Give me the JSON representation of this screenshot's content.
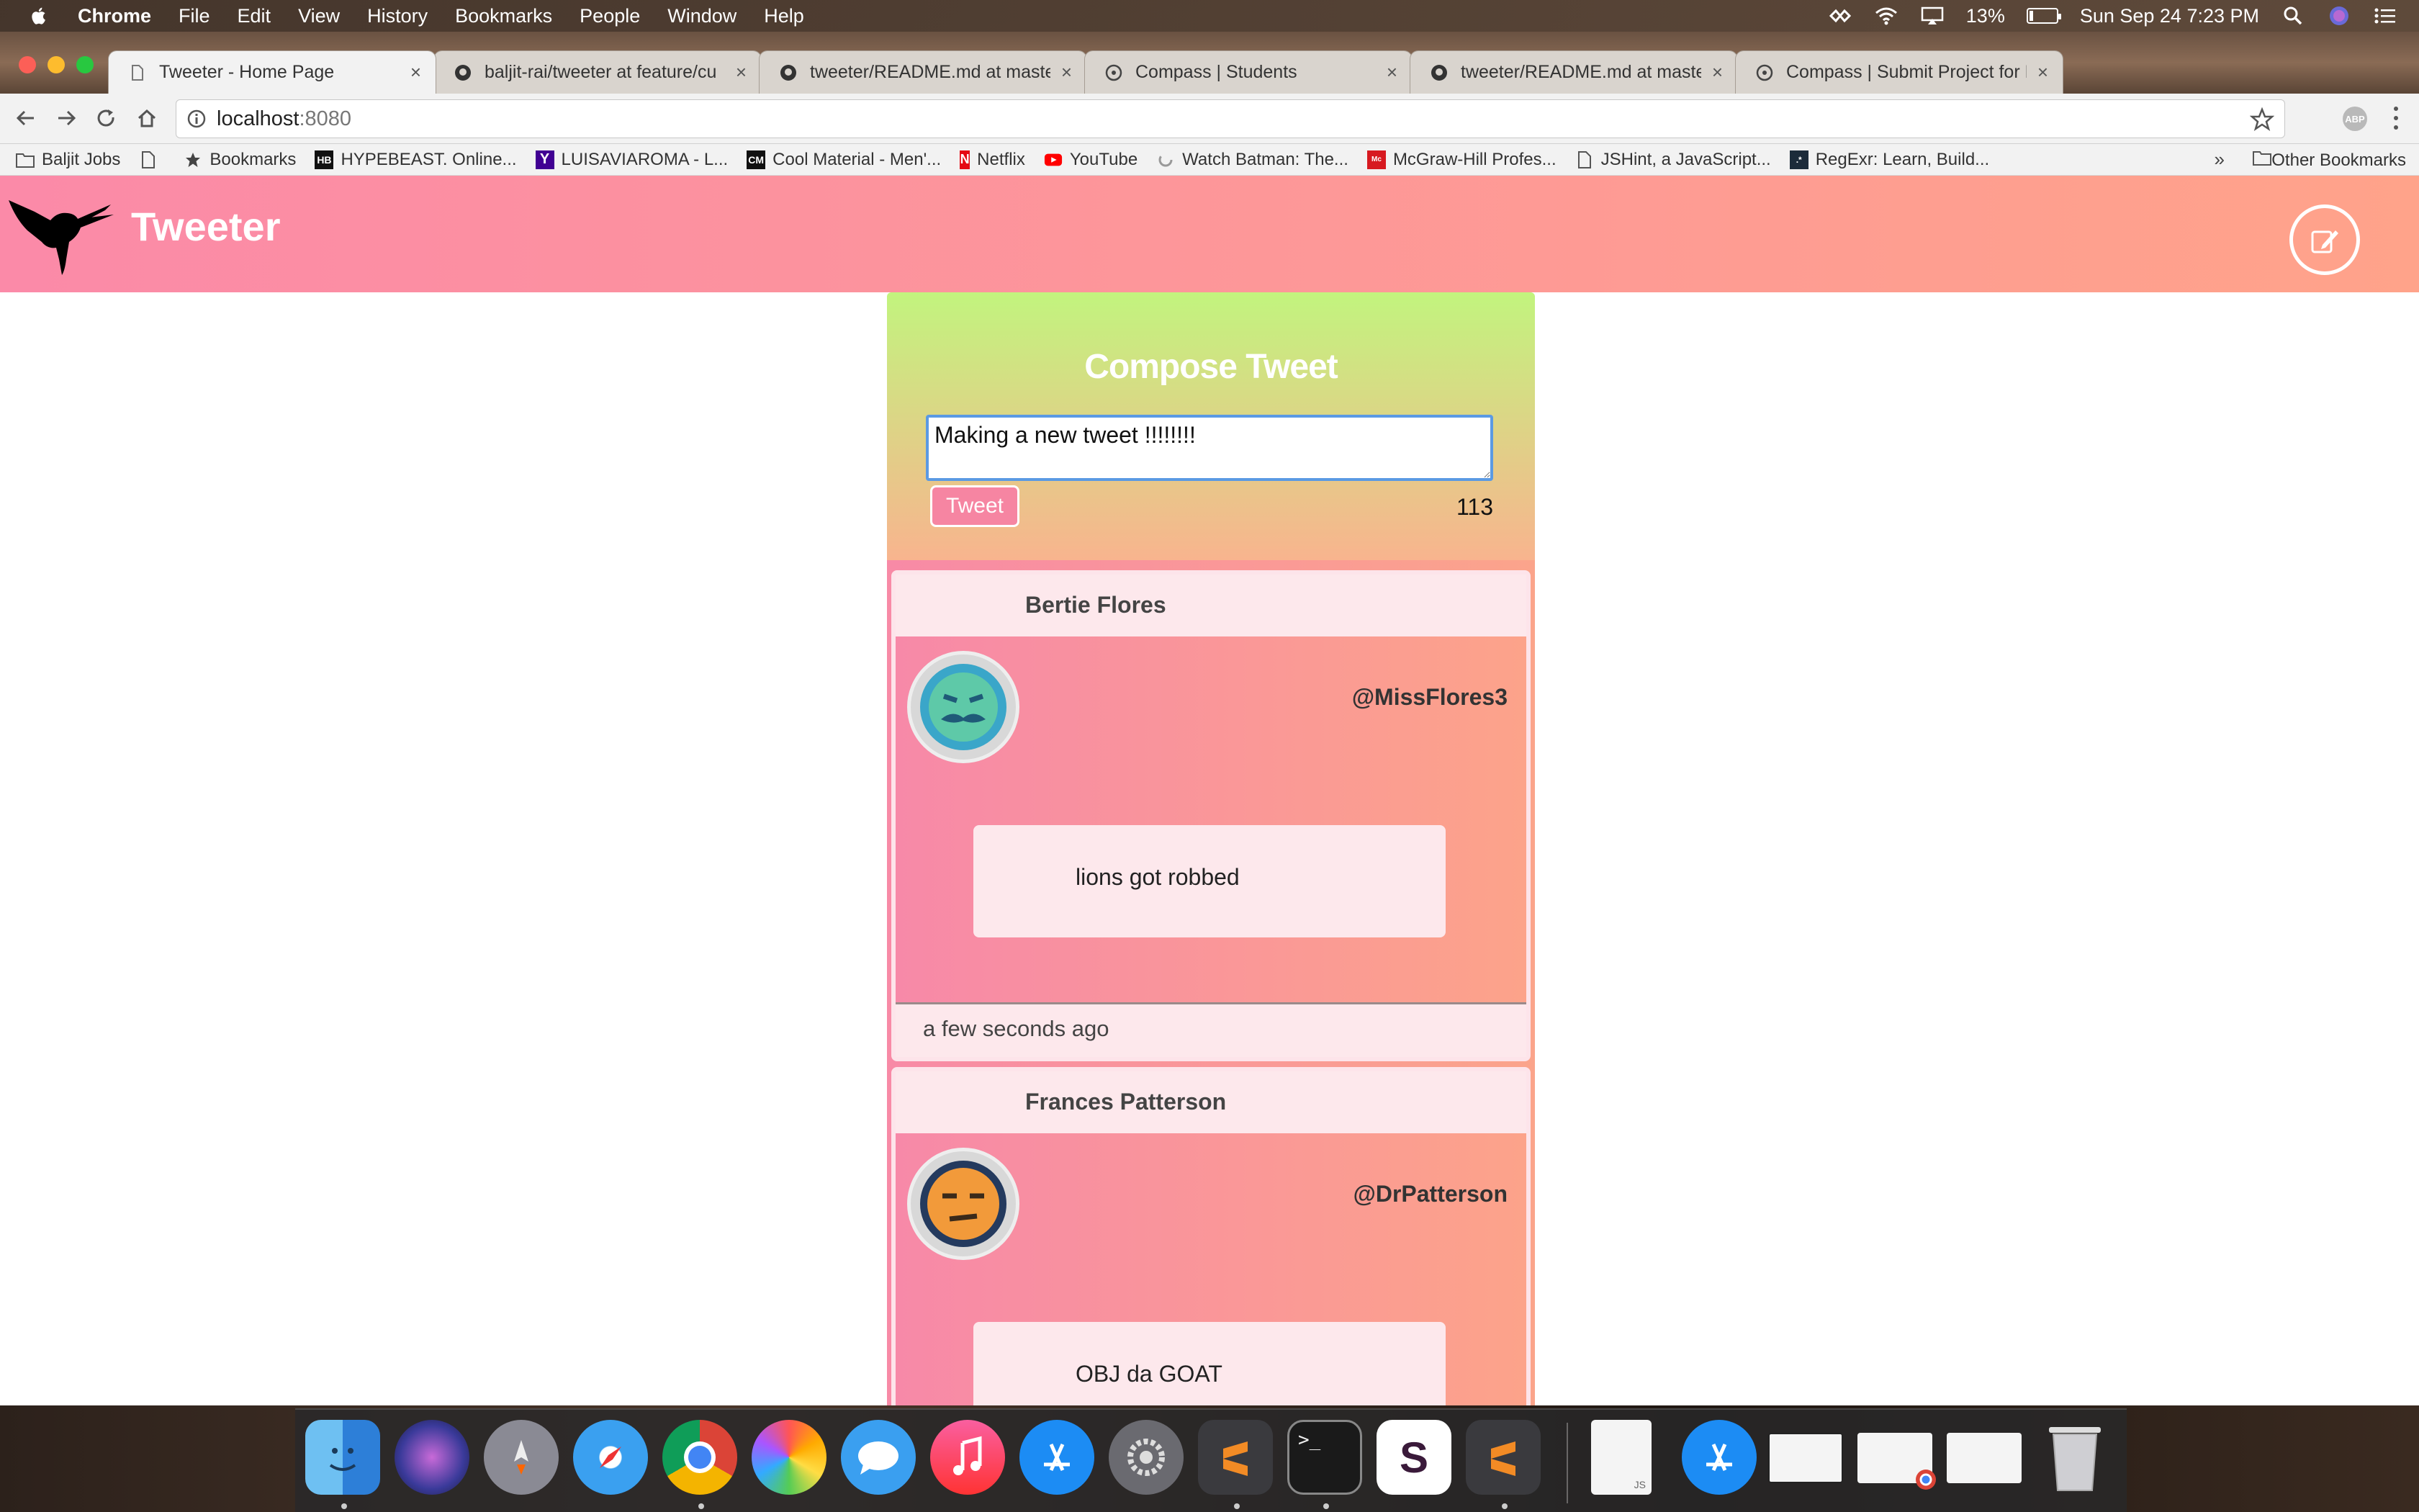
{
  "menubar": {
    "app_name": "Chrome",
    "items": [
      "File",
      "Edit",
      "View",
      "History",
      "Bookmarks",
      "People",
      "Window",
      "Help"
    ],
    "battery": "13%",
    "datetime": "Sun Sep 24  7:23 PM"
  },
  "tabs": [
    {
      "title": "Tweeter - Home Page",
      "icon": "document-icon",
      "active": true
    },
    {
      "title": "baljit-rai/tweeter at feature/cu",
      "icon": "github-icon",
      "active": false
    },
    {
      "title": "tweeter/README.md at master",
      "icon": "github-icon",
      "active": false
    },
    {
      "title": "Compass | Students",
      "icon": "compass-icon",
      "active": false
    },
    {
      "title": "tweeter/README.md at master",
      "icon": "github-icon",
      "active": false
    },
    {
      "title": "Compass | Submit Project for F",
      "icon": "compass-icon",
      "active": false
    }
  ],
  "omnibox": {
    "host": "localhost",
    "port": ":8080"
  },
  "bookmarks": {
    "items": [
      {
        "label": "Baljit Jobs",
        "icon": "folder-icon"
      },
      {
        "label": "",
        "icon": "document-icon"
      },
      {
        "label": "Bookmarks",
        "icon": "star-icon"
      },
      {
        "label": "HYPEBEAST. Online...",
        "icon": "hb-icon"
      },
      {
        "label": "LUISAVIAROMA - L...",
        "icon": "yahoo-icon"
      },
      {
        "label": "Cool Material - Men'...",
        "icon": "cm-icon"
      },
      {
        "label": "Netflix",
        "icon": "netflix-icon"
      },
      {
        "label": "YouTube",
        "icon": "youtube-icon"
      },
      {
        "label": "Watch Batman: The...",
        "icon": "loading-icon"
      },
      {
        "label": "McGraw-Hill Profes...",
        "icon": "mcgraw-icon"
      },
      {
        "label": "JSHint, a JavaScript...",
        "icon": "document-icon"
      },
      {
        "label": "RegExr: Learn, Build...",
        "icon": "regexr-icon"
      }
    ],
    "overflow": "»",
    "other": "Other Bookmarks"
  },
  "site": {
    "title": "Tweeter",
    "compose": {
      "heading": "Compose Tweet",
      "text": "Making a new tweet !!!!!!!!",
      "button": "Tweet",
      "counter": "113"
    },
    "tweets": [
      {
        "name": "Bertie Flores",
        "handle": "@MissFlores3",
        "text": "lions got robbed",
        "time": "a few seconds ago",
        "avatar_color": "#3aa6c9"
      },
      {
        "name": "Frances Patterson",
        "handle": "@DrPatterson",
        "text": "OBJ da GOAT",
        "time": "",
        "avatar_color": "#f29a3a"
      }
    ]
  },
  "dock": {
    "apps": [
      "finder-icon",
      "siri-icon",
      "launchpad-icon",
      "safari-icon",
      "chrome-icon",
      "photos-icon",
      "messages-icon",
      "itunes-icon",
      "app-store-icon",
      "system-preferences-icon",
      "sublime-text-icon",
      "terminal-icon",
      "slack-icon",
      "sublime-text-icon",
      "document-icon",
      "app-store-downloads-icon",
      "window-thumbnail-icon",
      "chrome-window-icon",
      "spreadsheet-icon",
      "trash-icon"
    ]
  },
  "colors": {
    "header_start": "#fb8aa8",
    "header_end": "#ffa38a",
    "compose_top": "#c2f47e",
    "compose_bottom": "#f8b48e",
    "tweet_button": "#f685a2"
  }
}
